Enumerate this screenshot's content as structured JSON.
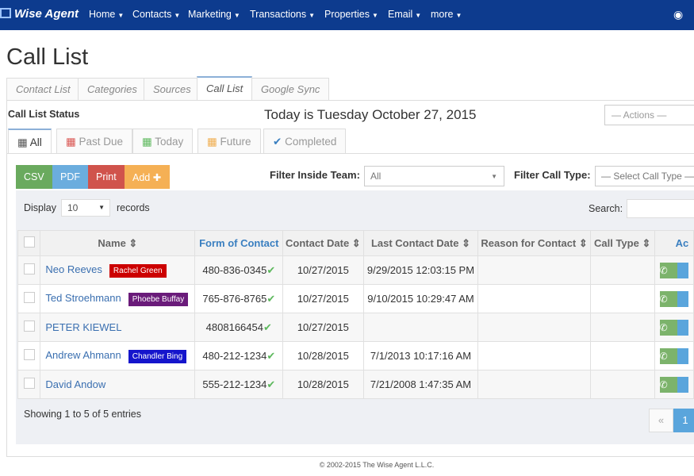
{
  "nav": {
    "brand": "Wise Agent",
    "items": [
      "Home",
      "Contacts",
      "Marketing",
      "Transactions",
      "Properties",
      "Email",
      "more"
    ]
  },
  "page_title": "Call List",
  "tabs": [
    "Contact List",
    "Categories",
    "Sources",
    "Call List",
    "Google Sync"
  ],
  "active_tab": "Call List",
  "status_label": "Call List Status",
  "today": "Today is Tuesday October 27, 2015",
  "actions_placeholder": "— Actions —",
  "status_tabs": [
    {
      "label": "All",
      "icon": "calendar-icon",
      "color": "#555"
    },
    {
      "label": "Past Due",
      "icon": "calendar-icon",
      "color": "#d9534f"
    },
    {
      "label": "Today",
      "icon": "calendar-icon",
      "color": "#5cb85c"
    },
    {
      "label": "Future",
      "icon": "calendar-icon",
      "color": "#f0ad4e"
    },
    {
      "label": "Completed",
      "icon": "check-icon",
      "color": "#3a7fc0"
    }
  ],
  "export": {
    "csv": "CSV",
    "pdf": "PDF",
    "print": "Print",
    "add": "Add ✚"
  },
  "filter_team": {
    "label": "Filter Inside Team:",
    "value": "All"
  },
  "filter_type": {
    "label": "Filter Call Type:",
    "placeholder": "— Select Call Type —"
  },
  "display": {
    "label": "Display",
    "value": "10",
    "suffix": "records"
  },
  "search_label": "Search:",
  "columns": [
    "Name",
    "Form of Contact",
    "Contact Date",
    "Last Contact Date",
    "Reason for Contact",
    "Call Type",
    "Ac"
  ],
  "rows": [
    {
      "name": "Neo Reeves",
      "tag": "Rachel Green",
      "tag_color": "#cc0000",
      "phone": "480-836-0345",
      "contact_date": "10/27/2015",
      "last": "9/29/2015 12:03:15 PM"
    },
    {
      "name": "Ted Stroehmann",
      "tag": "Phoebe Buffay",
      "tag_color": "#6a1b7a",
      "phone": "765-876-8765",
      "contact_date": "10/27/2015",
      "last": "9/10/2015 10:29:47 AM"
    },
    {
      "name": "PETER KIEWEL",
      "tag": "",
      "tag_color": "",
      "phone": "4808166454",
      "contact_date": "10/27/2015",
      "last": ""
    },
    {
      "name": "Andrew Ahmann",
      "tag": "Chandler Bing",
      "tag_color": "#1515cc",
      "phone": "480-212-1234",
      "contact_date": "10/28/2015",
      "last": "7/1/2013 10:17:16 AM"
    },
    {
      "name": "David Andow",
      "tag": "",
      "tag_color": "",
      "phone": "555-212-1234",
      "contact_date": "10/28/2015",
      "last": "7/21/2008 1:47:35 AM"
    }
  ],
  "showing": "Showing 1 to 5 of 5 entries",
  "pagination": {
    "prev": "«",
    "current": "1"
  },
  "copyright": "© 2002-2015 The Wise Agent L.L.C."
}
